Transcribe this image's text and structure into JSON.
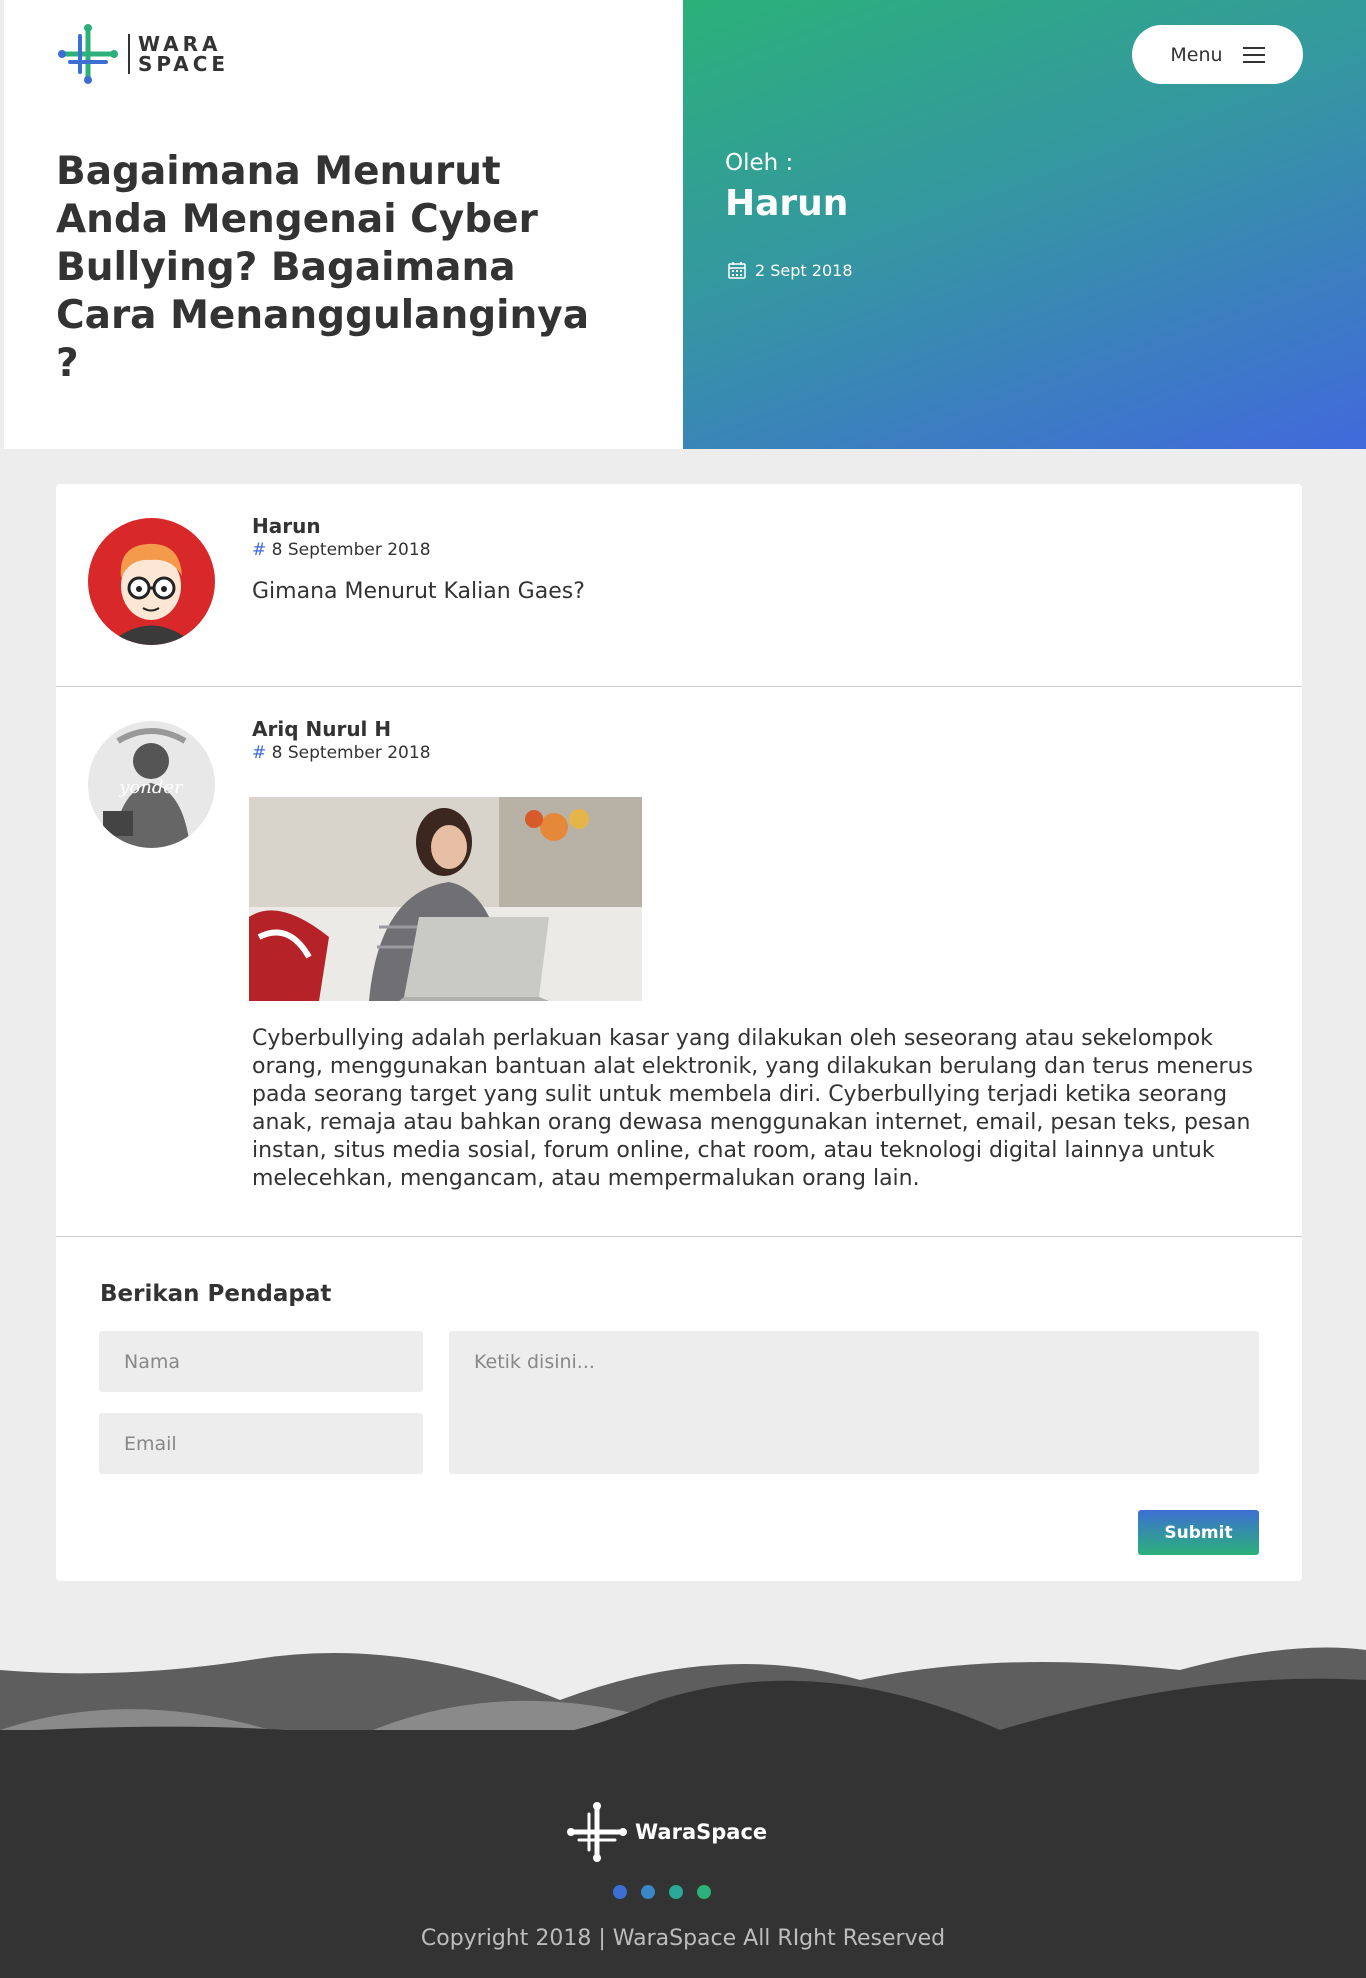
{
  "header": {
    "logo_line1": "WARA",
    "logo_line2": "SPACE",
    "title": "Bagaimana Menurut Anda Mengenai Cyber Bullying? Bagaimana Cara Menanggulanginya ?",
    "menu_label": "Menu",
    "by_label": "Oleh :",
    "author": "Harun",
    "date": "2 Sept 2018"
  },
  "comments": [
    {
      "name": "Harun",
      "hash": "#",
      "date": "8 September 2018",
      "text": "Gimana Menurut Kalian Gaes?"
    },
    {
      "name": "Ariq Nurul H",
      "hash": "#",
      "date": "8 September 2018",
      "avatar_text": "yonder",
      "text": "Cyberbullying adalah perlakuan kasar yang dilakukan oleh seseorang atau sekelompok orang, menggunakan bantuan alat elektronik, yang dilakukan berulang dan terus menerus pada seorang target yang sulit untuk membela diri. Cyberbullying terjadi ketika seorang anak, remaja atau bahkan orang dewasa menggunakan internet, email, pesan teks, pesan instan, situs media sosial, forum online, chat room, atau teknologi digital lainnya untuk melecehkan, mengancam, atau mempermalukan orang lain."
    }
  ],
  "form": {
    "title": "Berikan Pendapat",
    "name_placeholder": "Nama",
    "email_placeholder": "Email",
    "message_placeholder": "Ketik disini...",
    "submit_label": "Submit"
  },
  "footer": {
    "brand": "WaraSpace",
    "copyright": "Copyright 2018 | WaraSpace All RIght Reserved",
    "dot_colors": [
      "#3d6fd3",
      "#3a86c6",
      "#2aa99a",
      "#2bb179"
    ]
  },
  "colors": {
    "green": "#2bb179",
    "blue": "#4169dc",
    "footer_dark": "#333333"
  }
}
